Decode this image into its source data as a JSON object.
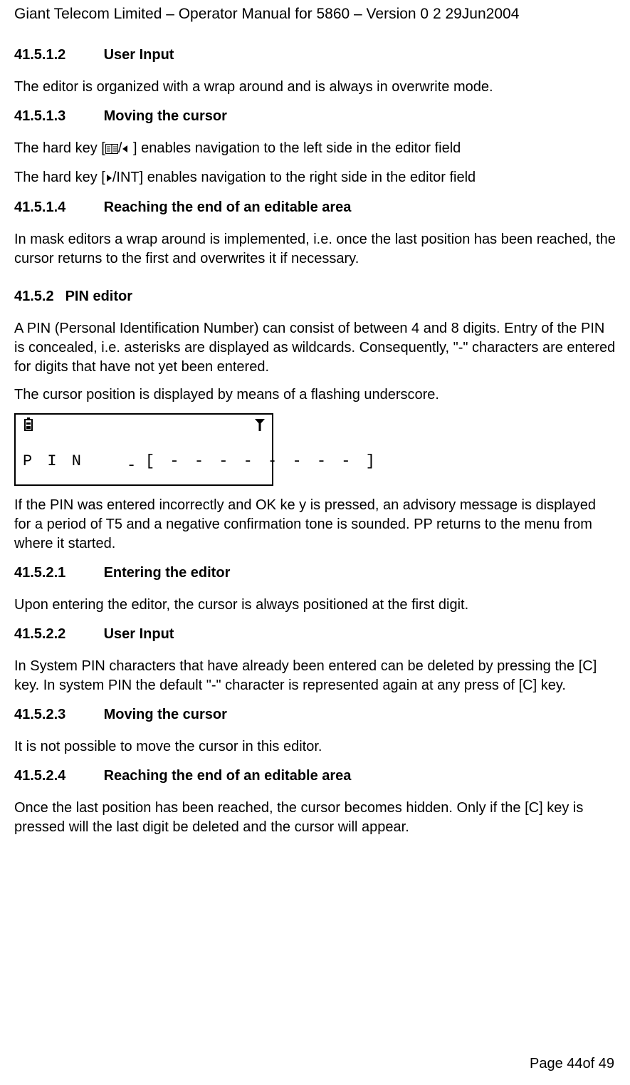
{
  "header": "Giant Telecom Limited – Operator Manual for 5860 – Version 0 2 29Jun2004",
  "sections": {
    "s41512": {
      "num": "41.5.1.2",
      "title": "User Input"
    },
    "s41513": {
      "num": "41.5.1.3",
      "title": "Moving the cursor"
    },
    "s41514": {
      "num": "41.5.1.4",
      "title": "Reaching the end of an editable area"
    },
    "s4152": {
      "num": "41.5.2",
      "title": "PIN editor"
    },
    "s41521": {
      "num": "41.5.2.1",
      "title": "Entering the editor"
    },
    "s41522": {
      "num": "41.5.2.2",
      "title": "User Input"
    },
    "s41523": {
      "num": "41.5.2.3",
      "title": "Moving the cursor"
    },
    "s41524": {
      "num": "41.5.2.4",
      "title": "Reaching the end of an editable area"
    }
  },
  "paras": {
    "p1": "The editor is organized with a wrap around and is always in overwrite mode.",
    "p2a": "The hard key [",
    "p2b": "/",
    "p2c": " ] enables navigation to the left side in the editor field",
    "p3a": "The hard key [",
    "p3b": "/INT] enables navigation to the right side in the editor field",
    "p4": "In mask editors a wrap around is implemented, i.e. once the last position has been reached, the cursor returns to the first and overwrites it if necessary.",
    "p5": "A PIN (Personal Identification Number) can consist of between 4 and 8 digits. Entry of the PIN is concealed, i.e. asterisks are displayed as wildcards. Consequently, \"-\" characters are entered for digits that have not yet been entered.",
    "p6": "The cursor position is displayed by means of a flashing underscore.",
    "p7": "If the PIN was entered incorrectly and OK ke y is pressed, an advisory message is displayed for a period of T5 and a negative confirmation tone is sounded. PP returns to the menu from where it started.",
    "p8": "Upon entering the editor, the cursor is always positioned at the first digit.",
    "p9": "In System PIN characters that have already been entered can be deleted by pressing the [C] key. In system PIN the default \"-\" character is represented again at any press of [C] key.",
    "p10": "It is not possible to move the cursor in this editor.",
    "p11": "Once the last position has been reached, the cursor becomes hidden. Only if the [C] key is pressed will the last digit be deleted and the cursor will appear."
  },
  "pin_display": {
    "text": "P I N     [ - - - - - - - - ]",
    "cursor": "-"
  },
  "footer": "Page 44of 49"
}
